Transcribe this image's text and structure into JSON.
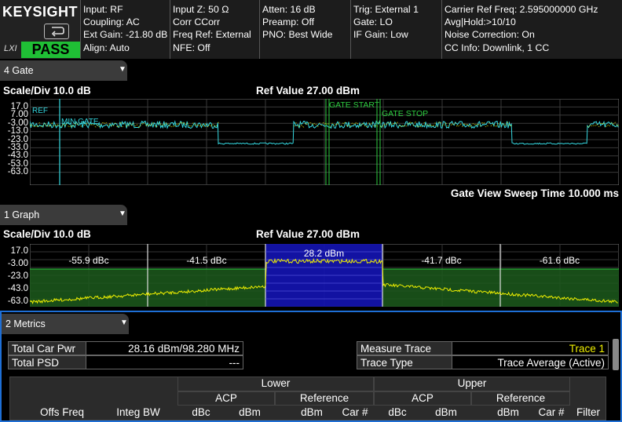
{
  "header": {
    "brand": "KEYSIGHT",
    "status_badge": "PASS",
    "lxi_label": "LXI",
    "col1": [
      "Input: RF",
      "Coupling: AC",
      "Ext Gain: -21.80 dB",
      "Align: Auto"
    ],
    "col2": [
      "Input Z: 50 Ω",
      "Corr CCorr",
      "Freq Ref: External",
      "NFE: Off"
    ],
    "col3": [
      "Atten: 16 dB",
      "Preamp: Off",
      "PNO: Best Wide"
    ],
    "col4": [
      "Trig: External 1",
      "Gate: LO",
      "IF Gain: Low"
    ],
    "col5": [
      "Carrier Ref Freq: 2.595000000 GHz",
      "Avg|Hold:>10/10",
      "Noise Correction: On",
      "CC Info: Downlink, 1 CC"
    ],
    "colors": {
      "pass": "#1fbf35",
      "trace_cyan": "#35d8e0",
      "trace_yellow": "#f0f000",
      "gate_green": "#2ecc40",
      "highlight_blue": "#1414b4"
    }
  },
  "gate_window": {
    "tab_label": "4 Gate",
    "scale": "Scale/Div 10.0 dB",
    "ref_value": "Ref Value 27.00 dBm",
    "y_ticks": [
      "17.0",
      "7.00",
      "-3.00",
      "-13.0",
      "-23.0",
      "-33.0",
      "-43.0",
      "-53.0",
      "-63.0"
    ],
    "markers": {
      "ref": "REF",
      "min_gate": "MIN GATE",
      "gate_start": "GATE START",
      "gate_stop": "GATE STOP"
    },
    "sweep_time": "Gate View Sweep Time 10.000 ms"
  },
  "graph_window": {
    "tab_label": "1 Graph",
    "scale": "Scale/Div 10.0 dB",
    "ref_value": "Ref Value 27.00 dBm",
    "y_ticks": [
      "17.0",
      "-3.00",
      "-23.0",
      "-43.0",
      "-63.0"
    ],
    "segments": [
      "-55.9 dBc",
      "-41.5 dBc",
      "28.2 dBm",
      "-41.7 dBc",
      "-61.6 dBc"
    ]
  },
  "metrics_window": {
    "tab_label": "2 Metrics",
    "total_car_pwr_label": "Total Car Pwr",
    "total_car_pwr_value": "28.16 dBm/98.280 MHz",
    "total_psd_label": "Total PSD",
    "total_psd_value": "---",
    "measure_trace_label": "Measure Trace",
    "measure_trace_value": "Trace 1",
    "trace_type_label": "Trace Type",
    "trace_type_value": "Trace Average (Active)",
    "table": {
      "group_lower": "Lower",
      "group_upper": "Upper",
      "sub_acp": "ACP",
      "sub_reference": "Reference",
      "columns": [
        "Offs Freq",
        "Integ BW",
        "dBc",
        "dBm",
        "dBm",
        "Car #",
        "dBc",
        "dBm",
        "dBm",
        "Car #",
        "Filter"
      ]
    }
  }
}
